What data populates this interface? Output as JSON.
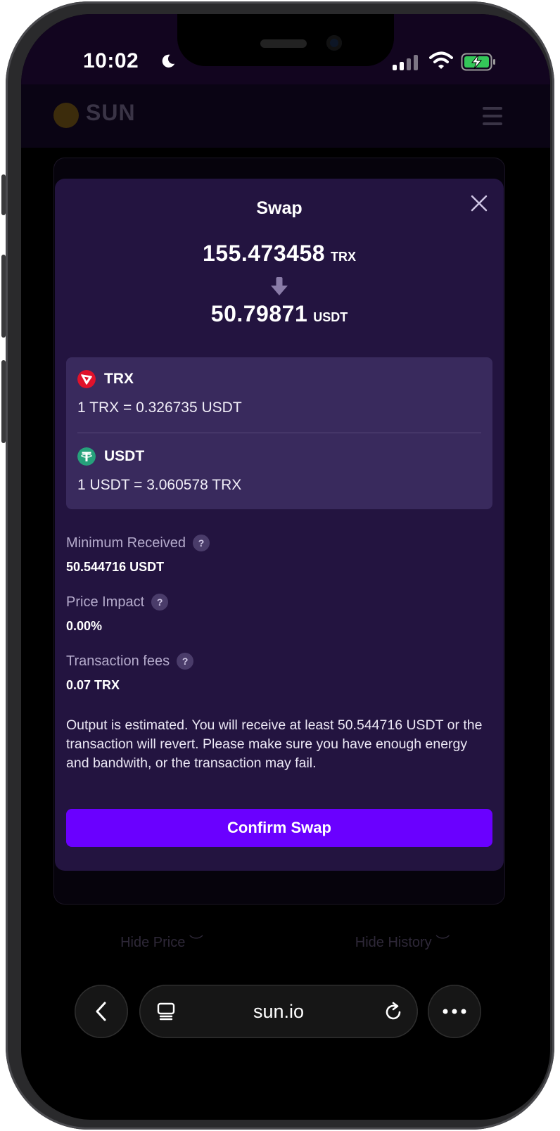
{
  "status_bar": {
    "time": "10:02"
  },
  "app": {
    "brand": "SUN",
    "bg_buttons": {
      "hide_price": "Hide Price",
      "hide_history": "Hide History"
    }
  },
  "modal": {
    "title": "Swap",
    "from": {
      "amount": "155.473458",
      "unit": "TRX"
    },
    "to": {
      "amount": "50.79871",
      "unit": "USDT"
    },
    "rates": [
      {
        "token": "TRX",
        "rate": "1 TRX = 0.326735 USDT"
      },
      {
        "token": "USDT",
        "rate": "1 USDT = 3.060578 TRX"
      }
    ],
    "details": [
      {
        "label": "Minimum Received",
        "value": "50.544716 USDT"
      },
      {
        "label": "Price Impact",
        "value": "0.00%"
      },
      {
        "label": "Transaction fees",
        "value": "0.07 TRX"
      }
    ],
    "help_glyph": "?",
    "note": "Output is estimated. You will receive at least 50.544716 USDT or the transaction will revert. Please make sure you have enough energy and bandwith, or the transaction may fail.",
    "confirm_label": "Confirm Swap"
  },
  "browser": {
    "url": "sun.io"
  },
  "colors": {
    "accent": "#6a00ff",
    "modal_bg": "#231440",
    "rates_bg": "#392a5d",
    "trx_red": "#e0122b",
    "usdt_green": "#26a17b"
  }
}
